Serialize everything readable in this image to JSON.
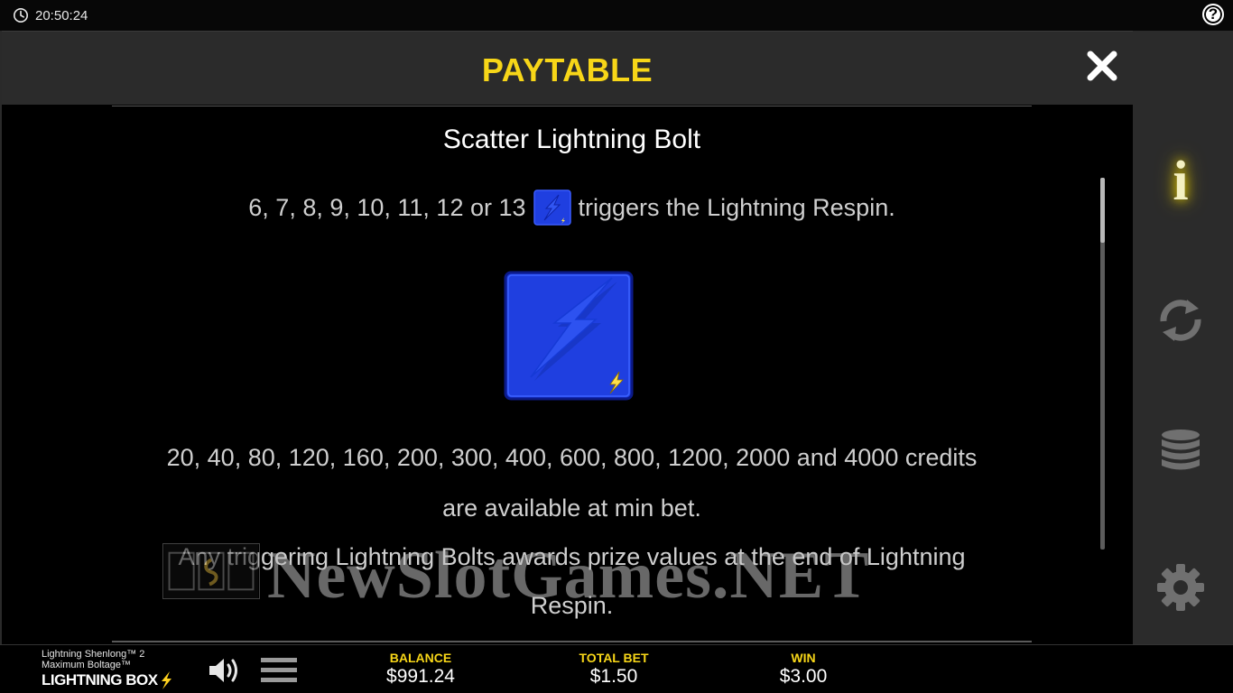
{
  "status_bar": {
    "time": "20:50:24",
    "help_label": "?"
  },
  "paytable": {
    "title": "PAYTABLE",
    "section_title": "Scatter Lightning Bolt",
    "trigger_prefix": "6, 7, 8, 9, 10, 11, 12 or 13",
    "trigger_suffix": "triggers the Lightning Respin.",
    "credits_line1": "20, 40, 80, 120, 160, 200, 300, 400, 600, 800, 1200, 2000 and 4000 credits",
    "credits_line2": "are available at min bet.",
    "award_line1": "Any triggering Lightning Bolts awards prize values at the end of Lightning",
    "award_line2": "Respin."
  },
  "watermark": {
    "text": "NewSlotGames.NET"
  },
  "sidebar": {
    "info_label": "i"
  },
  "bottom_bar": {
    "game_name_line1": "Lightning Shenlong™ 2",
    "game_name_line2": "Maximum Boltage™",
    "brand": "LIGHTNING BOX",
    "balance_label": "BALANCE",
    "balance_value": "$991.24",
    "total_bet_label": "TOTAL BET",
    "total_bet_value": "$1.50",
    "win_label": "WIN",
    "win_value": "$3.00"
  },
  "colors": {
    "accent_yellow": "#f7d618",
    "panel_header": "#2b2b2b",
    "tile_blue": "#1f3fe0"
  }
}
